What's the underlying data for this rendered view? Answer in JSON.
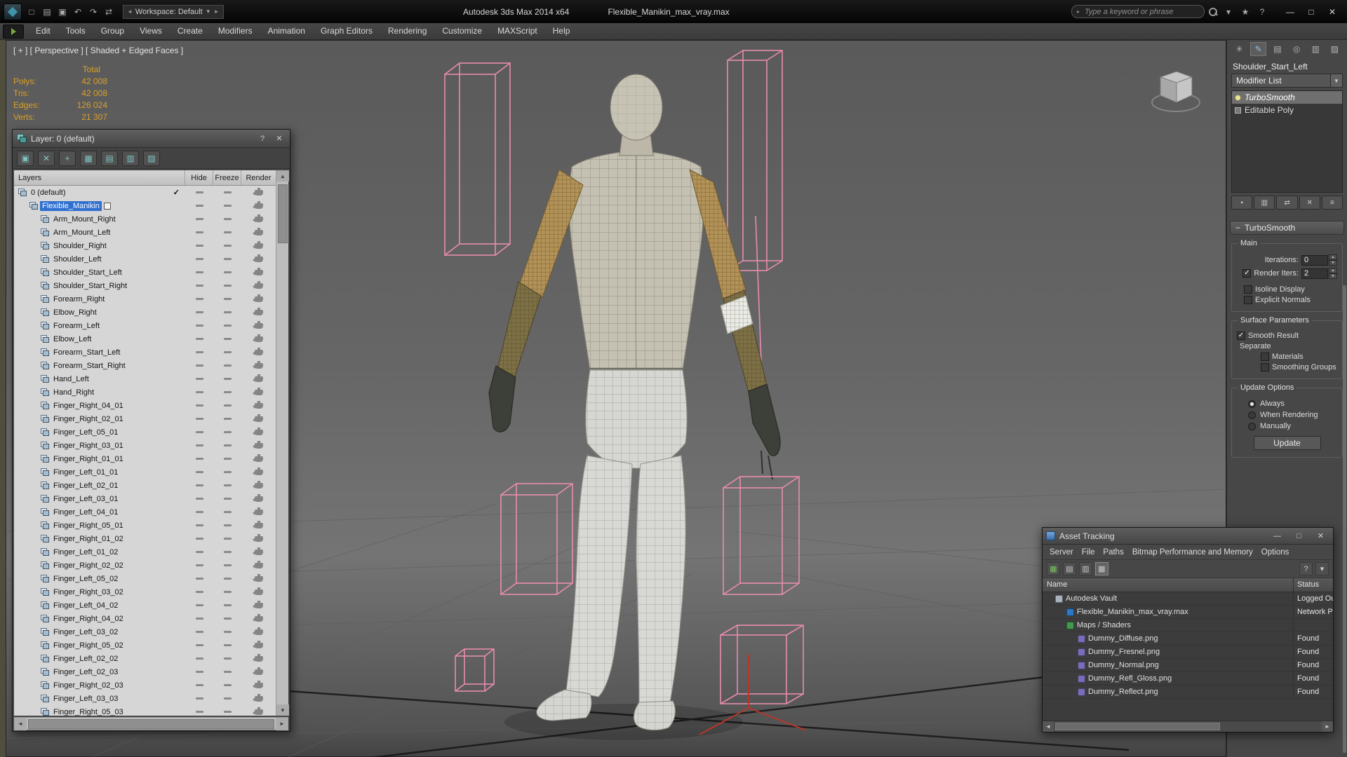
{
  "glyphs": {
    "close": "✕",
    "minimize": "—",
    "maximize": "□",
    "help": "?",
    "check": "✓",
    "dropdown": "▼",
    "left_arrow": "◄",
    "right_arrow": "►",
    "up_arrow": "▲",
    "down_arrow": "▼",
    "small_right": "▸",
    "minus": "−"
  },
  "colors": {
    "selection_blue": "#2e6fd0",
    "helper_pink": "#ee8fb2",
    "stats_orange": "#d9a02a"
  },
  "titlebar": {
    "workspace": "Workspace: Default",
    "app_title": "Autodesk 3ds Max  2014 x64",
    "doc_title": "Flexible_Manikin_max_vray.max",
    "search_placeholder": "Type a keyword or phrase",
    "left_icons": [
      {
        "name": "new-scene-icon",
        "glyph": "□"
      },
      {
        "name": "open-file-icon",
        "glyph": "▤"
      },
      {
        "name": "save-file-icon",
        "glyph": "▣"
      },
      {
        "name": "undo-icon",
        "glyph": "↶"
      },
      {
        "name": "redo-icon",
        "glyph": "↷"
      },
      {
        "name": "project-folder-icon",
        "glyph": "⇄"
      }
    ],
    "right_icons": [
      {
        "name": "communication-center-icon",
        "glyph": "▾"
      },
      {
        "name": "favorites-icon",
        "glyph": "★"
      },
      {
        "name": "help-icon",
        "glyph": "?"
      }
    ]
  },
  "menubar": {
    "items": [
      "Edit",
      "Tools",
      "Group",
      "Views",
      "Create",
      "Modifiers",
      "Animation",
      "Graph Editors",
      "Rendering",
      "Customize",
      "MAXScript",
      "Help"
    ]
  },
  "viewport": {
    "label": "[ + ] [ Perspective ] [ Shaded + Edged Faces ]",
    "stats": {
      "total_label": "Total",
      "rows": [
        {
          "label": "Polys:",
          "value": "42 008"
        },
        {
          "label": "Tris:",
          "value": "42 008"
        },
        {
          "label": "Edges:",
          "value": "126 024"
        },
        {
          "label": "Verts:",
          "value": "21 307"
        }
      ]
    }
  },
  "layer_dialog": {
    "title": "Layer: 0 (default)",
    "columns": [
      "Layers",
      "Hide",
      "Freeze",
      "Render"
    ],
    "toolbar": [
      {
        "name": "create-new-layer-icon",
        "glyph": "▣"
      },
      {
        "name": "delete-layer-icon",
        "glyph": "✕"
      },
      {
        "name": "add-selection-to-layer-icon",
        "glyph": "+"
      },
      {
        "name": "select-objects-in-layer-icon",
        "glyph": "▦"
      },
      {
        "name": "set-current-layer-icon",
        "glyph": "▤"
      },
      {
        "name": "highlight-layer-icon",
        "glyph": "▥"
      },
      {
        "name": "layer-properties-icon",
        "glyph": "▨"
      }
    ],
    "rows": [
      {
        "name": "0 (default)",
        "level": 0,
        "current": true
      },
      {
        "name": "Flexible_Manikin",
        "level": 1,
        "selected": true
      },
      {
        "name": "Arm_Mount_Right",
        "level": 2
      },
      {
        "name": "Arm_Mount_Left",
        "level": 2
      },
      {
        "name": "Shoulder_Right",
        "level": 2
      },
      {
        "name": "Shoulder_Left",
        "level": 2
      },
      {
        "name": "Shoulder_Start_Left",
        "level": 2
      },
      {
        "name": "Shoulder_Start_Right",
        "level": 2
      },
      {
        "name": "Forearm_Right",
        "level": 2
      },
      {
        "name": "Elbow_Right",
        "level": 2
      },
      {
        "name": "Forearm_Left",
        "level": 2
      },
      {
        "name": "Elbow_Left",
        "level": 2
      },
      {
        "name": "Forearm_Start_Left",
        "level": 2
      },
      {
        "name": "Forearm_Start_Right",
        "level": 2
      },
      {
        "name": "Hand_Left",
        "level": 2
      },
      {
        "name": "Hand_Right",
        "level": 2
      },
      {
        "name": "Finger_Right_04_01",
        "level": 2
      },
      {
        "name": "Finger_Right_02_01",
        "level": 2
      },
      {
        "name": "Finger_Left_05_01",
        "level": 2
      },
      {
        "name": "Finger_Right_03_01",
        "level": 2
      },
      {
        "name": "Finger_Right_01_01",
        "level": 2
      },
      {
        "name": "Finger_Left_01_01",
        "level": 2
      },
      {
        "name": "Finger_Left_02_01",
        "level": 2
      },
      {
        "name": "Finger_Left_03_01",
        "level": 2
      },
      {
        "name": "Finger_Left_04_01",
        "level": 2
      },
      {
        "name": "Finger_Right_05_01",
        "level": 2
      },
      {
        "name": "Finger_Right_01_02",
        "level": 2
      },
      {
        "name": "Finger_Left_01_02",
        "level": 2
      },
      {
        "name": "Finger_Right_02_02",
        "level": 2
      },
      {
        "name": "Finger_Left_05_02",
        "level": 2
      },
      {
        "name": "Finger_Right_03_02",
        "level": 2
      },
      {
        "name": "Finger_Left_04_02",
        "level": 2
      },
      {
        "name": "Finger_Right_04_02",
        "level": 2
      },
      {
        "name": "Finger_Left_03_02",
        "level": 2
      },
      {
        "name": "Finger_Right_05_02",
        "level": 2
      },
      {
        "name": "Finger_Left_02_02",
        "level": 2
      },
      {
        "name": "Finger_Left_02_03",
        "level": 2
      },
      {
        "name": "Finger_Right_02_03",
        "level": 2
      },
      {
        "name": "Finger_Left_03_03",
        "level": 2
      },
      {
        "name": "Finger_Right_05_03",
        "level": 2
      }
    ]
  },
  "command_panel": {
    "tabs": [
      {
        "name": "tab-create-icon",
        "glyph": "✳"
      },
      {
        "name": "tab-modify-icon",
        "glyph": "✎",
        "active": true
      },
      {
        "name": "tab-hierarchy-icon",
        "glyph": "▤"
      },
      {
        "name": "tab-motion-icon",
        "glyph": "◎"
      },
      {
        "name": "tab-display-icon",
        "glyph": "▥"
      },
      {
        "name": "tab-utilities-icon",
        "glyph": "▨"
      }
    ],
    "object_name": "Shoulder_Start_Left",
    "modifier_list_label": "Modifier List",
    "stack": [
      {
        "label": "TurboSmooth",
        "selected": true,
        "italic": true,
        "icon": "bulb"
      },
      {
        "label": "Editable Poly",
        "icon": "poly"
      }
    ],
    "stack_buttons": [
      {
        "name": "pin-stack-icon",
        "glyph": "▪"
      },
      {
        "name": "show-end-result-icon",
        "glyph": "▥"
      },
      {
        "name": "make-unique-icon",
        "glyph": "⇄"
      },
      {
        "name": "remove-modifier-icon",
        "glyph": "✕"
      },
      {
        "name": "configure-modifier-sets-icon",
        "glyph": "≡"
      }
    ],
    "rollout_title": "TurboSmooth",
    "main": {
      "label": "Main",
      "iterations_label": "Iterations:",
      "iterations_value": "0",
      "render_iters_label": "Render Iters:",
      "render_iters_value": "2",
      "isoline_label": "Isoline Display",
      "explicit_label": "Explicit Normals"
    },
    "surface": {
      "label": "Surface Parameters",
      "smooth_result_label": "Smooth Result",
      "separate_label": "Separate",
      "materials_label": "Materials",
      "smoothing_groups_label": "Smoothing Groups"
    },
    "update": {
      "label": "Update Options",
      "options": [
        {
          "label": "Always",
          "selected": true
        },
        {
          "label": "When Rendering"
        },
        {
          "label": "Manually"
        }
      ],
      "button_label": "Update"
    }
  },
  "asset_tracking": {
    "title": "Asset Tracking",
    "menus": [
      "Server",
      "File",
      "Paths",
      "Bitmap Performance and Memory",
      "Options"
    ],
    "toolbar": [
      {
        "name": "export-table-icon",
        "glyph": "▦",
        "cls": "green"
      },
      {
        "name": "view-list-icon",
        "glyph": "▤"
      },
      {
        "name": "view-grid-icon",
        "glyph": "▥"
      },
      {
        "name": "view-details-icon",
        "glyph": "▦",
        "active": true
      }
    ],
    "right_icons": [
      {
        "name": "help-icon",
        "glyph": "?"
      },
      {
        "name": "options-dropdown-icon",
        "glyph": "▾"
      }
    ],
    "columns": [
      "Name",
      "Status"
    ],
    "rows": [
      {
        "name": "Autodesk Vault",
        "status": "Logged Ou",
        "level": 1,
        "icon": "vault"
      },
      {
        "name": "Flexible_Manikin_max_vray.max",
        "status": "Network Pa",
        "level": 2,
        "icon": "maxfile"
      },
      {
        "name": "Maps / Shaders",
        "status": "",
        "level": 2,
        "icon": "maps"
      },
      {
        "name": "Dummy_Diffuse.png",
        "status": "Found",
        "level": 3,
        "icon": "bitmap"
      },
      {
        "name": "Dummy_Fresnel.png",
        "status": "Found",
        "level": 3,
        "icon": "bitmap"
      },
      {
        "name": "Dummy_Normal.png",
        "status": "Found",
        "level": 3,
        "icon": "bitmap"
      },
      {
        "name": "Dummy_Refl_Gloss.png",
        "status": "Found",
        "level": 3,
        "icon": "bitmap"
      },
      {
        "name": "Dummy_Reflect.png",
        "status": "Found",
        "level": 3,
        "icon": "bitmap"
      }
    ]
  }
}
